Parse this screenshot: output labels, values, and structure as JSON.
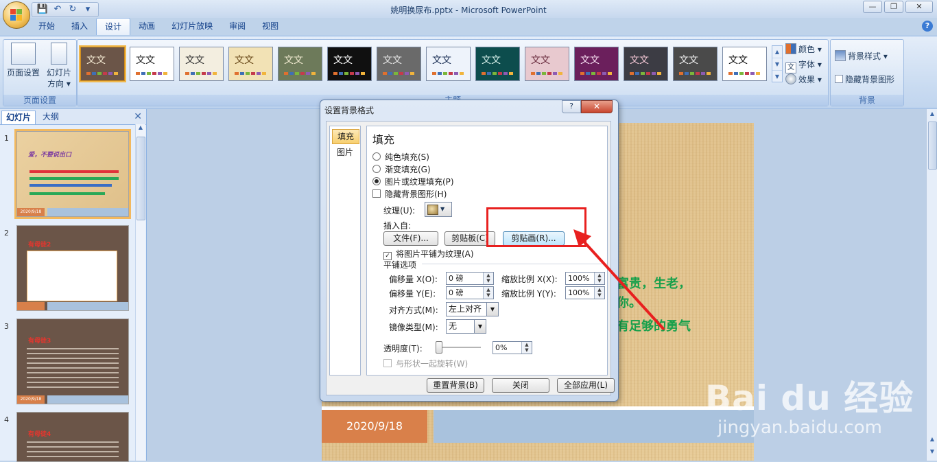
{
  "window": {
    "title": "姚明换尿布.pptx - Microsoft PowerPoint",
    "controls": {
      "minimize": "—",
      "maximize": "❐",
      "close": "✕"
    }
  },
  "quick_access": {
    "save": "💾",
    "undo": "↶",
    "redo": "↻",
    "more": "▾"
  },
  "tabs": [
    {
      "label": "开始"
    },
    {
      "label": "插入"
    },
    {
      "label": "设计",
      "active": true
    },
    {
      "label": "动画"
    },
    {
      "label": "幻灯片放映"
    },
    {
      "label": "审阅"
    },
    {
      "label": "视图"
    }
  ],
  "ribbon": {
    "page_setup_group": {
      "label": "页面设置",
      "page_setup_btn": "页面设置",
      "orientation_btn_line1": "幻灯片",
      "orientation_btn_line2": "方向 ▾"
    },
    "themes_group": {
      "label": "主题",
      "theme_text": "文文",
      "themes": [
        {
          "bg": "#6b5548",
          "fg": "#f3e9d2",
          "selected": true
        },
        {
          "bg": "#ffffff",
          "fg": "#222222"
        },
        {
          "bg": "#f3eee0",
          "fg": "#333333"
        },
        {
          "bg": "#f2e2b5",
          "fg": "#6a4a1a"
        },
        {
          "bg": "#6d7a5a",
          "fg": "#f0ead0"
        },
        {
          "bg": "#101010",
          "fg": "#ffffff"
        },
        {
          "bg": "#6a6a6a",
          "fg": "#e6e6e6"
        },
        {
          "bg": "#eef3fb",
          "fg": "#1b2f55"
        },
        {
          "bg": "#0d4d4d",
          "fg": "#d7f0ea"
        },
        {
          "bg": "#e8c9cf",
          "fg": "#6a2d3f"
        },
        {
          "bg": "#6b1f5c",
          "fg": "#f7e1f2"
        },
        {
          "bg": "#3c3c44",
          "fg": "#f2c6d4"
        },
        {
          "bg": "#4a4a4a",
          "fg": "#f0f0f0"
        },
        {
          "bg": "#ffffff",
          "fg": "#111111"
        }
      ],
      "colors_btn": "颜色 ▾",
      "fonts_btn": "字体 ▾",
      "effects_btn": "效果 ▾"
    },
    "background_group": {
      "label": "背景",
      "bg_styles_btn": "背景样式 ▾",
      "hide_bg_graphics": "隐藏背景图形"
    }
  },
  "left_pane": {
    "tab_slides": "幻灯片",
    "tab_outline": "大纲",
    "close": "✕",
    "slides": [
      {
        "num": "1",
        "title": "爱，不要说出口",
        "date": "2020/9/18"
      },
      {
        "num": "2",
        "title": "有母徒2"
      },
      {
        "num": "3",
        "title": "有母徒3",
        "date": "2020/9/18"
      },
      {
        "num": "4",
        "title": "有母徒4"
      }
    ]
  },
  "slide": {
    "text_line1": "富贵，生老，",
    "text_line2": "你。",
    "text_line3": "有足够的勇气",
    "footer_date": "2020/9/18"
  },
  "dialog": {
    "title": "设置背景格式",
    "help": "?",
    "close": "✕",
    "nav": [
      {
        "label": "填充",
        "active": true
      },
      {
        "label": "图片"
      }
    ],
    "heading": "填充",
    "options": {
      "solid_fill": "纯色填充(S)",
      "gradient_fill": "渐变填充(G)",
      "picture_texture_fill": "图片或纹理填充(P)",
      "hide_bg_graphics": "隐藏背景图形(H)"
    },
    "texture_label": "纹理(U):",
    "insert_from_label": "插入自:",
    "file_btn": "文件(F)...",
    "clipboard_btn": "剪贴板(C)",
    "clipart_btn": "剪贴画(R)...",
    "tile_checkbox": "将图片平铺为纹理(A)",
    "tiling_options": "平铺选项",
    "offset_x_label": "偏移量 X(O):",
    "offset_x_value": "0 磅",
    "offset_y_label": "偏移量 Y(E):",
    "offset_y_value": "0 磅",
    "scale_x_label": "缩放比例 X(X):",
    "scale_x_value": "100%",
    "scale_y_label": "缩放比例 Y(Y):",
    "scale_y_value": "100%",
    "alignment_label": "对齐方式(M):",
    "alignment_value": "左上对齐",
    "mirror_label": "镜像类型(M):",
    "mirror_value": "无",
    "transparency_label": "透明度(T):",
    "transparency_value": "0%",
    "transparency_level": 0,
    "rotate_with_shape": "与形状一起旋转(W)",
    "reset_btn": "重置背景(B)",
    "close_btn": "关闭",
    "apply_all_btn": "全部应用(L)"
  },
  "watermark": {
    "brand": "Bai du 经验",
    "url": "jingyan.baidu.com"
  }
}
